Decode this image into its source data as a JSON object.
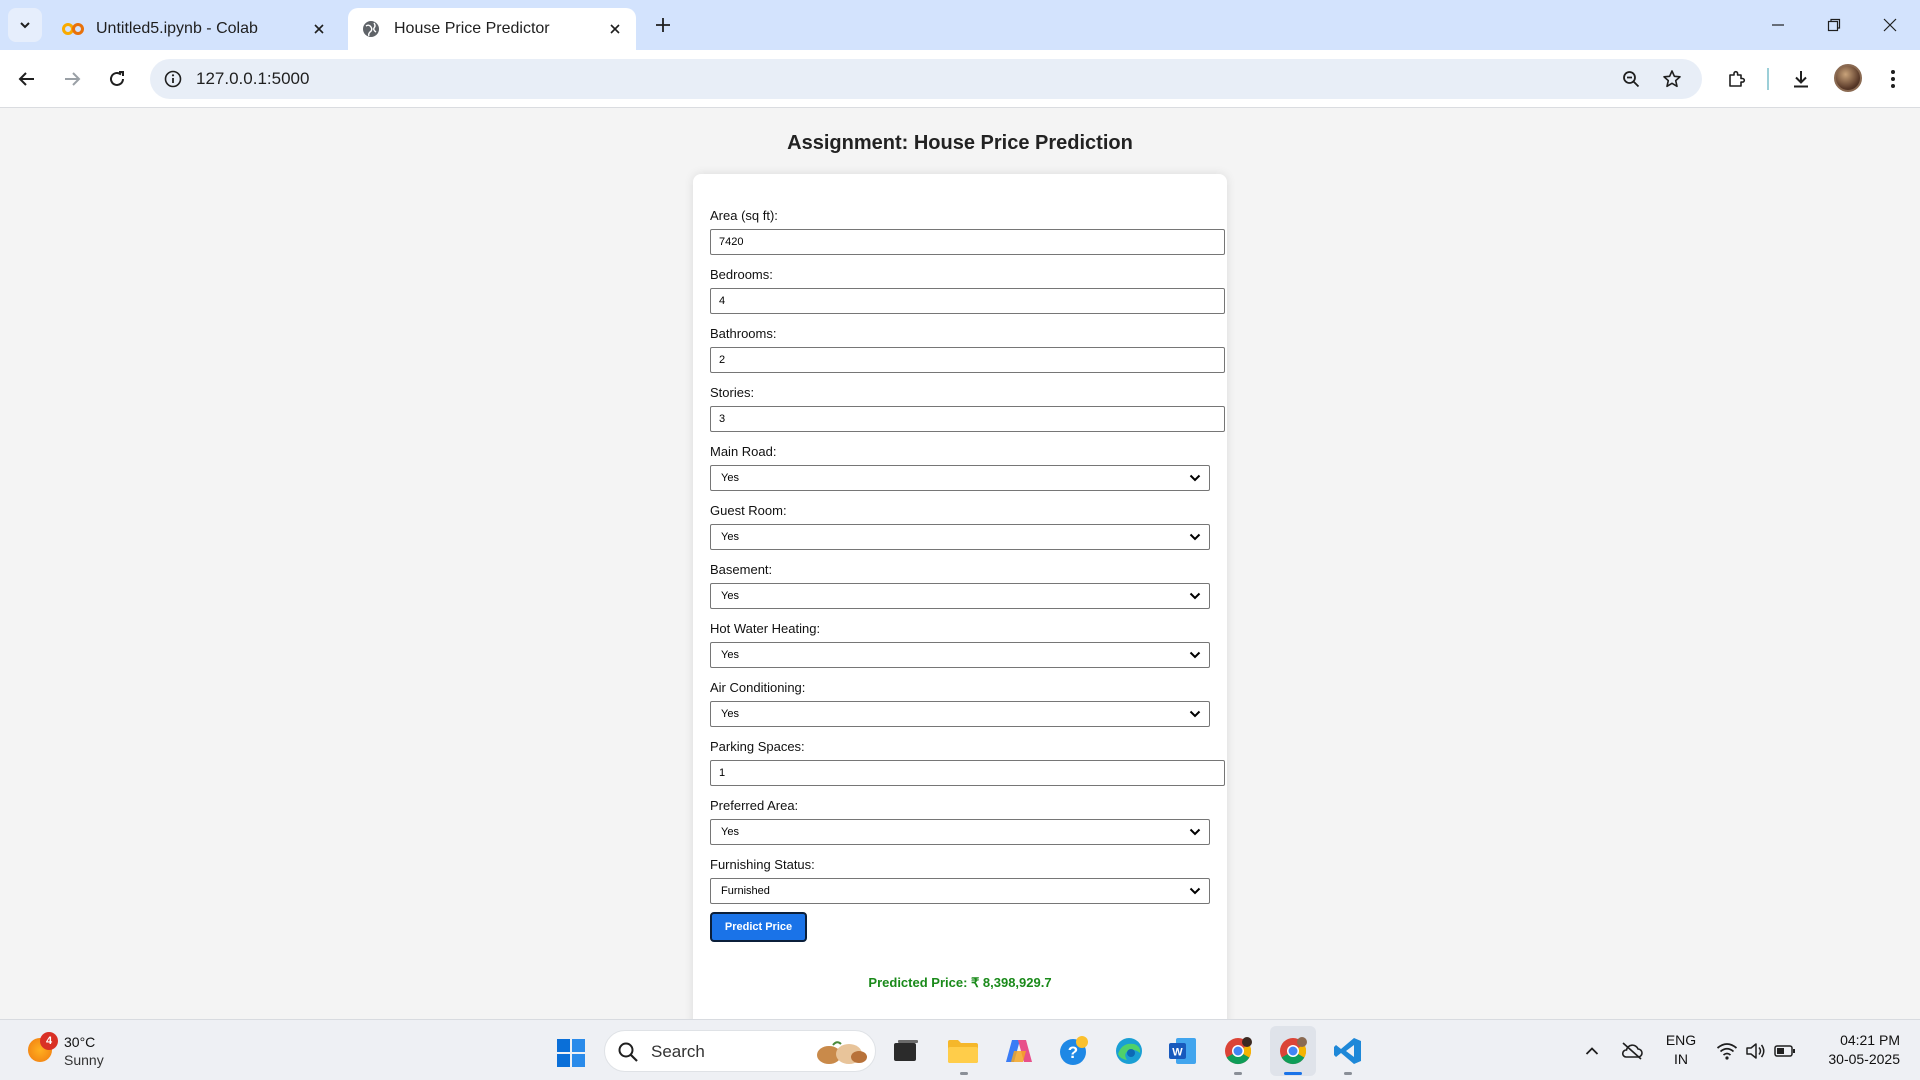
{
  "browser": {
    "tabs": [
      {
        "title": "Untitled5.ipynb - Colab",
        "favicon": "colab-icon",
        "active": false
      },
      {
        "title": "House Price Predictor",
        "favicon": "globe-icon",
        "active": true
      }
    ],
    "url": "127.0.0.1:5000"
  },
  "page": {
    "title": "Assignment: House Price Prediction",
    "fields": [
      {
        "label": "Area (sq ft):",
        "type": "input",
        "value": "7420"
      },
      {
        "label": "Bedrooms:",
        "type": "input",
        "value": "4"
      },
      {
        "label": "Bathrooms:",
        "type": "input",
        "value": "2"
      },
      {
        "label": "Stories:",
        "type": "input",
        "value": "3"
      },
      {
        "label": "Main Road:",
        "type": "select",
        "value": "Yes"
      },
      {
        "label": "Guest Room:",
        "type": "select",
        "value": "Yes"
      },
      {
        "label": "Basement:",
        "type": "select",
        "value": "Yes"
      },
      {
        "label": "Hot Water Heating:",
        "type": "select",
        "value": "Yes"
      },
      {
        "label": "Air Conditioning:",
        "type": "select",
        "value": "Yes"
      },
      {
        "label": "Parking Spaces:",
        "type": "input",
        "value": "1"
      },
      {
        "label": "Preferred Area:",
        "type": "select",
        "value": "Yes"
      },
      {
        "label": "Furnishing Status:",
        "type": "select",
        "value": "Furnished"
      }
    ],
    "submit_label": "Predict Price",
    "result": "Predicted Price: ₹ 8,398,929.7"
  },
  "taskbar": {
    "weather": {
      "badge": "4",
      "temp": "30°C",
      "desc": "Sunny"
    },
    "search_label": "Search",
    "lang": [
      "ENG",
      "IN"
    ],
    "time": "04:21 PM",
    "date": "30-05-2025"
  },
  "colors": {
    "accent": "#1a73e8",
    "result_green": "#1a8a1a",
    "tabbar_bg": "#d3e3fd"
  }
}
